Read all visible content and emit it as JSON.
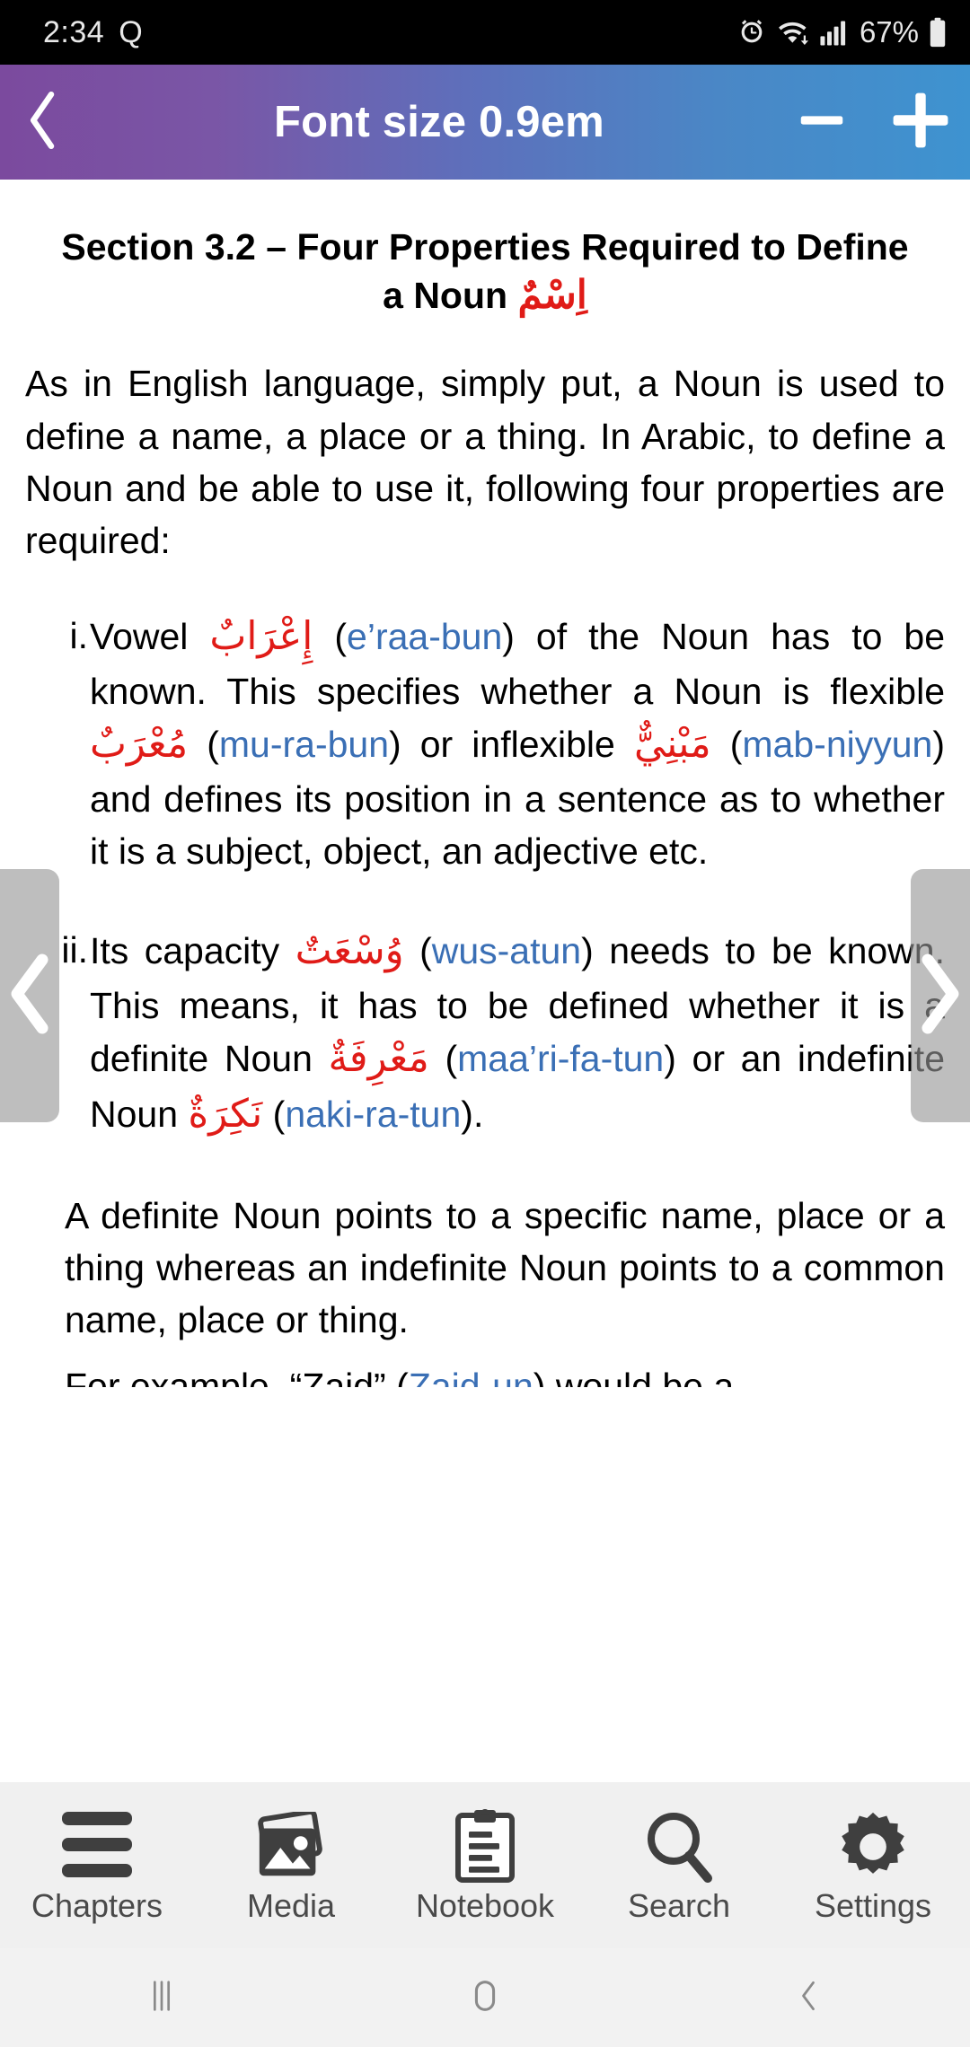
{
  "status_bar": {
    "time": "2:34",
    "indicator_letter": "Q",
    "icons": [
      "alarm-icon",
      "wifi-icon",
      "signal-icon"
    ],
    "battery_percent": "67%"
  },
  "header": {
    "back_icon": "chevron-left-icon",
    "title": "Font size 0.9em",
    "decrease_label": "−",
    "increase_label": "+",
    "gradient_start": "#7b4a9e",
    "gradient_end": "#3e93d0"
  },
  "document": {
    "title_main": "Section 3.2 – Four Properties Required to Define a Noun ",
    "title_arabic": "اِسْمٌ",
    "intro_paragraph": "As in English language, simply put, a Noun is used to define a name, a place or a thing. In Arabic, to define a Noun and be able to use it, following four properties are required:",
    "properties": [
      {
        "marker": "i.",
        "part1": "Vowel ",
        "arabic1": "إِعْرَابٌ",
        "part2": " (",
        "translit1": "e’raa-bun",
        "part3": ") of the Noun has to be known. This specifies whether a Noun is flexible ",
        "arabic2": "مُعْرَبٌ",
        "part4": " (",
        "translit2": "mu-ra-bun",
        "part5": ") or inflexible ",
        "arabic3": "مَبْنِيٌّ",
        "part6": " (",
        "translit3": "mab-niyyun",
        "part7": ") and defines its position in a sentence as to whether it is a subject, object, an adjective etc."
      },
      {
        "marker": "ii.",
        "part1": "Its capacity ",
        "arabic1": "وُسْعَتٌ",
        "part2": " (",
        "translit1": "wus-atun",
        "part3": ") needs to be known. This means, it has to be defined whether it is a definite Noun ",
        "arabic2": "مَعْرِفَةٌ",
        "part4": " (",
        "translit2": "maa’ri-fa-tun",
        "part5": ") or an indefinite Noun ",
        "arabic3": "نَكِرَةٌ",
        "part6": " (",
        "translit3": "naki-ra-tun",
        "part7": ")."
      }
    ],
    "closing_paragraph": "A definite Noun points to a specific name, place or a thing whereas an indefinite Noun points to a common name, place or thing.",
    "cutoff_line_prefix": "For example, “Zaid” (",
    "cutoff_line_translit": "Zaid-un",
    "cutoff_line_suffix": ") would be a",
    "arabic_color": "#e01b17",
    "translit_color": "#3a6fb5"
  },
  "page_nav": {
    "prev_icon": "chevron-left-icon",
    "next_icon": "chevron-right-icon"
  },
  "bottom_toolbar": {
    "items": [
      {
        "label": "Chapters",
        "icon": "hamburger-menu-icon"
      },
      {
        "label": "Media",
        "icon": "photos-icon"
      },
      {
        "label": "Notebook",
        "icon": "clipboard-icon"
      },
      {
        "label": "Search",
        "icon": "magnifier-icon"
      },
      {
        "label": "Settings",
        "icon": "gear-icon"
      }
    ]
  },
  "android_nav": {
    "recents_icon": "recents-icon",
    "home_icon": "home-icon",
    "back_icon": "back-chevron-icon"
  }
}
